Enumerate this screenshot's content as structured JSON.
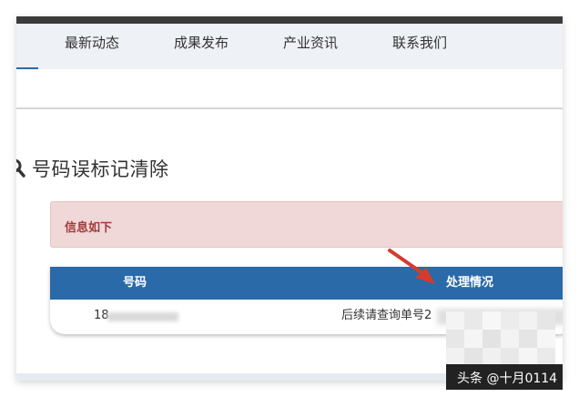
{
  "nav": {
    "items": [
      {
        "label": "最新动态"
      },
      {
        "label": "成果发布"
      },
      {
        "label": "产业资讯"
      },
      {
        "label": "联系我们"
      }
    ]
  },
  "page": {
    "title": "号码误标记清除"
  },
  "alert": {
    "text": "信息如下"
  },
  "table": {
    "headers": [
      "号码",
      "处理情况"
    ],
    "row": {
      "number_prefix": "18",
      "status_prefix": "后续请查询单号2"
    }
  },
  "watermark": {
    "text": "头条 @十月0114"
  },
  "colors": {
    "nav_bg": "#eef1f5",
    "table_header": "#2a6aa8",
    "alert_bg": "#f0d8d8",
    "alert_text": "#a33a3a",
    "arrow": "#d63a2e"
  }
}
